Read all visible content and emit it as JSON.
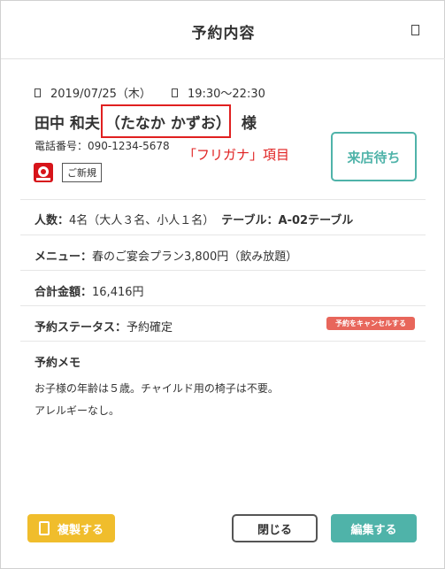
{
  "header": {
    "title": "予約内容",
    "close_icon": "close-icon"
  },
  "reservation": {
    "date": "2019/07/25（木）",
    "time": "19:30〜22:30",
    "name": "田中 和夫",
    "kana": "（たなか かずお）",
    "honorific": "様",
    "phone": "電話番号：090-1234-5678",
    "source_icon": "gurunavi-icon",
    "tag": "ご新規"
  },
  "annotation": "「フリガナ」項目",
  "status_button": "来店待ち",
  "details": {
    "people_label": "人数：",
    "people_value": "4名（大人３名、小人１名）",
    "table_label": "テーブル：",
    "table_value": "A-02テーブル",
    "menu_label": "メニュー：",
    "menu_value": "春のご宴会プラン3,800円（飲み放題）",
    "total_label": "合計金額：",
    "total_value": "16,416円",
    "status_label": "予約ステータス：",
    "status_value": "予約確定",
    "cancel_label": "予約をキャンセルする"
  },
  "memo": {
    "title": "予約メモ",
    "lines": [
      "お子様の年齢は５歳。チャイルド用の椅子は不要。",
      "アレルギーなし。"
    ]
  },
  "footer": {
    "copy_label": "複製する",
    "close_label": "閉じる",
    "edit_label": "編集する"
  },
  "colors": {
    "accent": "#4fb3a9",
    "copy": "#f0bd2c",
    "cancel": "#e8665b",
    "annotation": "#e02020"
  }
}
